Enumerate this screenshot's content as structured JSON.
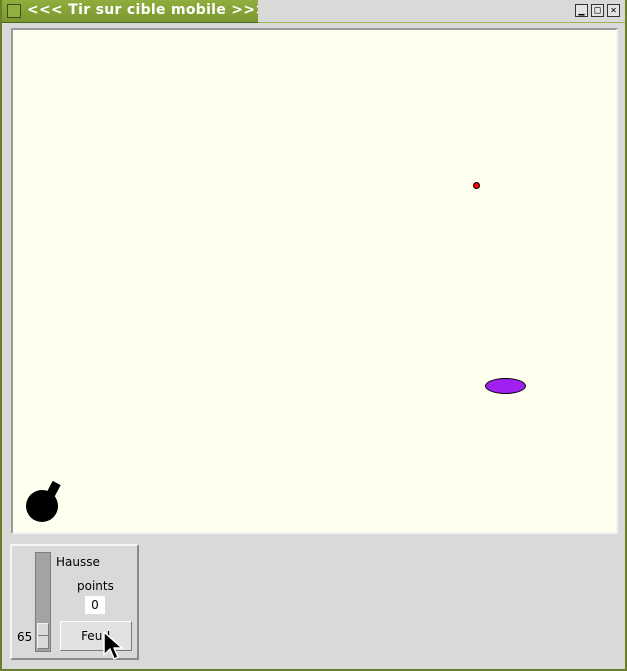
{
  "window": {
    "title": "<<< Tir sur cible mobile >>>",
    "controls": {
      "minimize": "▁",
      "maximize": "□",
      "close": "✕"
    }
  },
  "controls": {
    "scale_label": "Hausse",
    "scale_value": "65",
    "points_label": "points",
    "points_value": "0",
    "fire_button": "Feu !"
  },
  "colors": {
    "canvas_background": "#fffff0",
    "target": "#a020f0",
    "bullet": "#ff0000",
    "cannon": "#000000",
    "titlebar": "#7e9a32"
  },
  "icons": {
    "cursor": "arrow-cursor-icon"
  }
}
